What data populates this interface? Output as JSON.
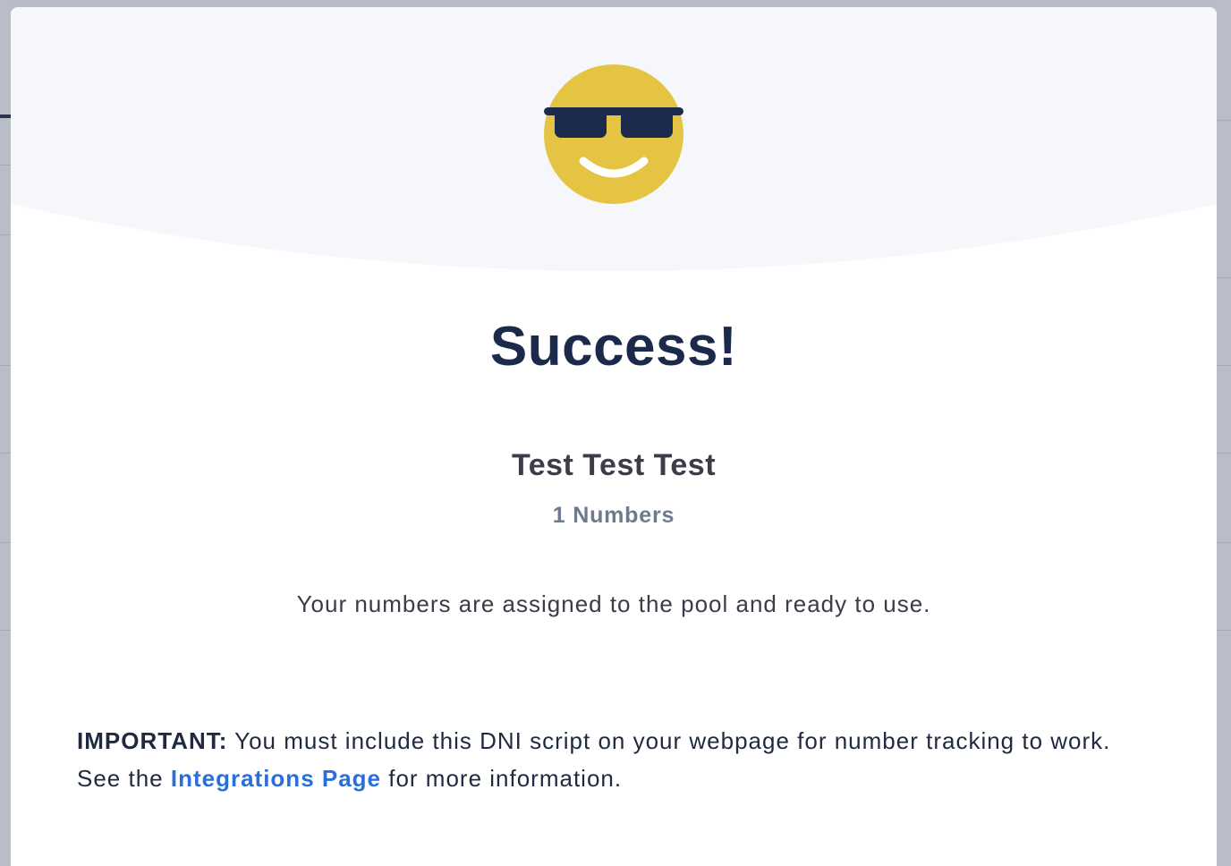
{
  "modal": {
    "hero_icon": "sunglasses-smiley-icon",
    "title": "Success!",
    "pool_name": "Test Test Test",
    "pool_count": "1 Numbers",
    "message": "Your numbers are assigned to the pool and ready to use.",
    "important": {
      "label": "IMPORTANT:",
      "text_before": " You must include this DNI script on your webpage for number tracking to work. See the ",
      "link_text": "Integrations Page",
      "text_after": " for more information."
    }
  },
  "colors": {
    "hero_background": "#f5f7fb",
    "emoji_face": "#e6c443",
    "emoji_glasses": "#1c2b4b",
    "title": "#1b2a4a",
    "link": "#2a6fd8",
    "backdrop": "#b8bcc8"
  }
}
